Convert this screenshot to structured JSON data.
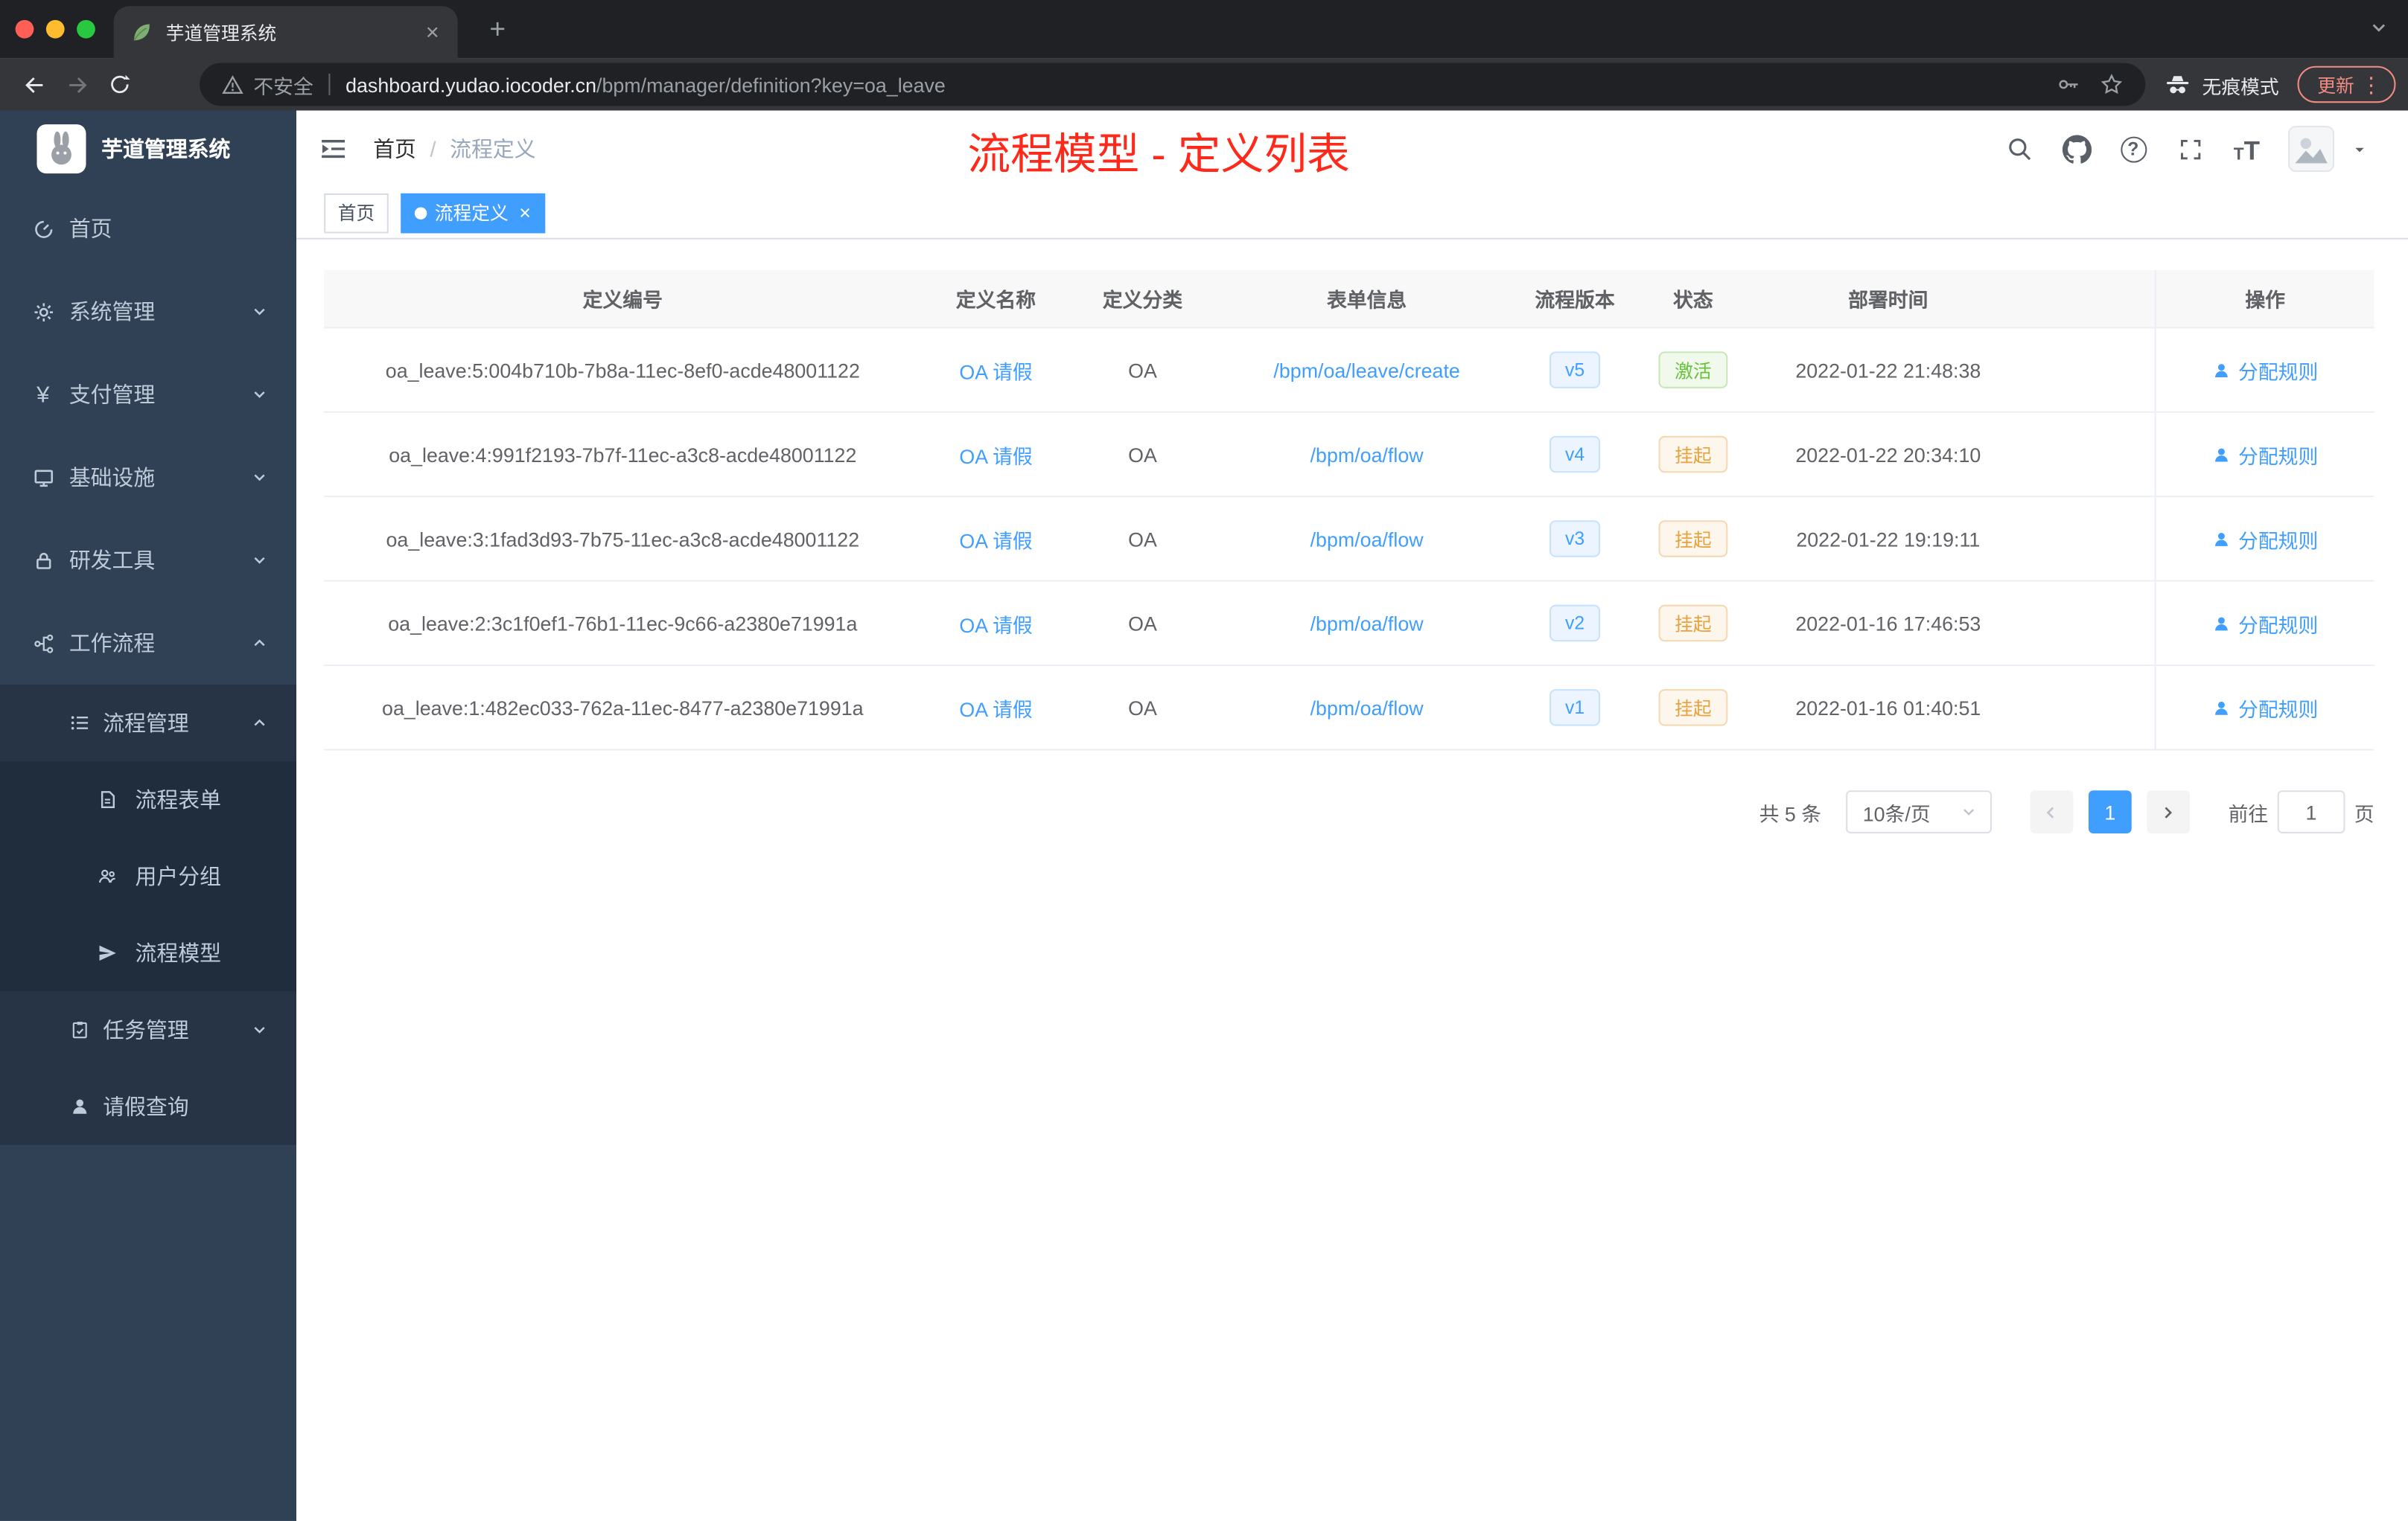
{
  "colors": {
    "accent": "#409eff",
    "success": "#67c23a",
    "warning": "#e6a23c",
    "annotation_red": "#fd2a1b",
    "sidebar_bg": "#304156"
  },
  "icons": {
    "close": "×",
    "plus": "+",
    "dots_vertical": "⋮",
    "yen": "¥",
    "question": "?",
    "divider": "|",
    "font_small": "T",
    "font_big": "T"
  },
  "browser": {
    "tab_title": "芋道管理系统",
    "security_label": "不安全",
    "url_host": "dashboard.yudao.iocoder.cn",
    "url_path": "/bpm/manager/definition?key=oa_leave",
    "incognito_label": "无痕模式",
    "update_label": "更新"
  },
  "sidebar": {
    "logo_title": "芋道管理系统",
    "items": [
      {
        "label": "首页"
      },
      {
        "label": "系统管理"
      },
      {
        "label": "支付管理"
      },
      {
        "label": "基础设施"
      },
      {
        "label": "研发工具"
      },
      {
        "label": "工作流程"
      },
      {
        "label": "流程管理"
      },
      {
        "label": "流程表单"
      },
      {
        "label": "用户分组"
      },
      {
        "label": "流程模型"
      },
      {
        "label": "任务管理"
      },
      {
        "label": "请假查询"
      }
    ]
  },
  "navbar": {
    "breadcrumb_home": "首页",
    "breadcrumb_sep": "/",
    "breadcrumb_current": "流程定义",
    "annotation": "流程模型 - 定义列表"
  },
  "tags": {
    "home": "首页",
    "active": "流程定义"
  },
  "table": {
    "columns": [
      "定义编号",
      "定义名称",
      "定义分类",
      "表单信息",
      "流程版本",
      "状态",
      "部署时间",
      "操作"
    ],
    "rows": [
      {
        "id": "oa_leave:5:004b710b-7b8a-11ec-8ef0-acde48001122",
        "name": "OA 请假",
        "category": "OA",
        "form": "/bpm/oa/leave/create",
        "version": "v5",
        "status": "激活",
        "time": "2022-01-22 21:48:38",
        "action": "分配规则"
      },
      {
        "id": "oa_leave:4:991f2193-7b7f-11ec-a3c8-acde48001122",
        "name": "OA 请假",
        "category": "OA",
        "form": "/bpm/oa/flow",
        "version": "v4",
        "status": "挂起",
        "time": "2022-01-22 20:34:10",
        "action": "分配规则"
      },
      {
        "id": "oa_leave:3:1fad3d93-7b75-11ec-a3c8-acde48001122",
        "name": "OA 请假",
        "category": "OA",
        "form": "/bpm/oa/flow",
        "version": "v3",
        "status": "挂起",
        "time": "2022-01-22 19:19:11",
        "action": "分配规则"
      },
      {
        "id": "oa_leave:2:3c1f0ef1-76b1-11ec-9c66-a2380e71991a",
        "name": "OA 请假",
        "category": "OA",
        "form": "/bpm/oa/flow",
        "version": "v2",
        "status": "挂起",
        "time": "2022-01-16 17:46:53",
        "action": "分配规则"
      },
      {
        "id": "oa_leave:1:482ec033-762a-11ec-8477-a2380e71991a",
        "name": "OA 请假",
        "category": "OA",
        "form": "/bpm/oa/flow",
        "version": "v1",
        "status": "挂起",
        "time": "2022-01-16 01:40:51",
        "action": "分配规则"
      }
    ]
  },
  "pagination": {
    "total": "共 5 条",
    "page_size": "10条/页",
    "current_page": "1",
    "goto_label": "前往",
    "goto_value": "1",
    "page_label": "页"
  }
}
